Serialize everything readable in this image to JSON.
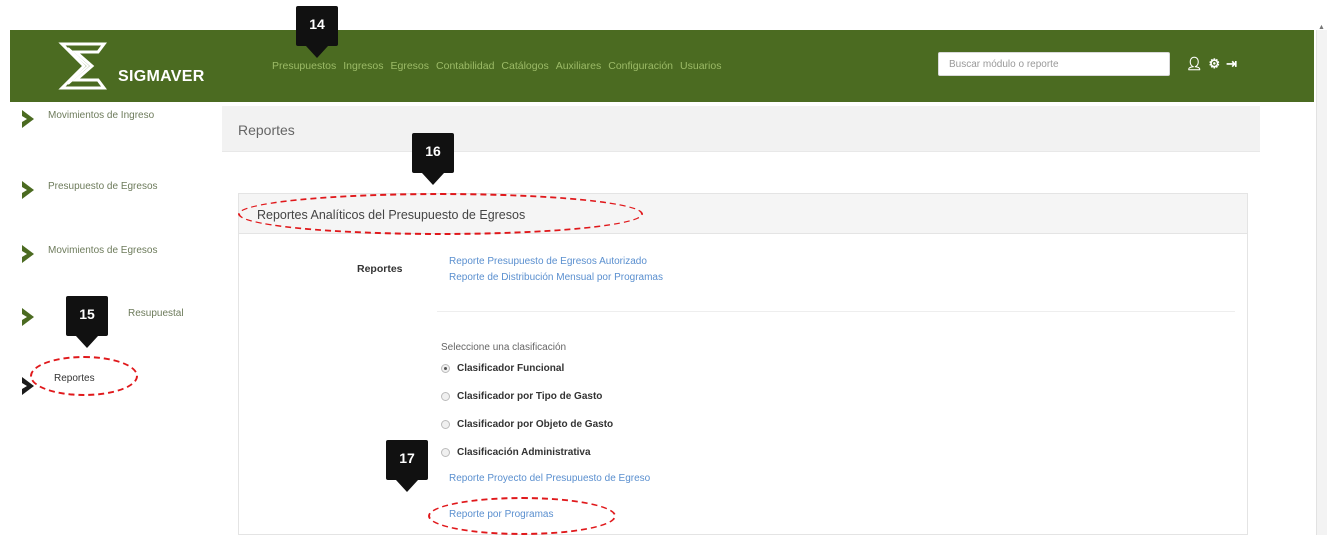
{
  "app": {
    "brand": "SIGMAVER",
    "nav": [
      "Presupuestos",
      "Ingresos",
      "Egresos",
      "Contabilidad",
      "Catálogos",
      "Auxiliares",
      "Configuración",
      "Usuarios"
    ],
    "search_placeholder": "Buscar módulo o reporte",
    "colors": {
      "topbar": "#4b6b21",
      "link": "#5a8fcf",
      "annotation": "#e0181b"
    }
  },
  "sidebar": {
    "items": [
      {
        "label": "Movimientos de Ingreso"
      },
      {
        "label": "Presupuesto de Egresos"
      },
      {
        "label": "Movimientos de Egresos"
      },
      {
        "label": "Resupuestal"
      },
      {
        "label": "Reportes"
      }
    ]
  },
  "main": {
    "page_title": "Reportes",
    "panel_title": "Reportes Analíticos del Presupuesto de Egresos",
    "reports_label": "Reportes",
    "report_links": [
      "Reporte Presupuesto de Egresos Autorizado",
      "Reporte de Distribución Mensual por Programas"
    ],
    "classification_title": "Seleccione una clasificación",
    "classifications": [
      {
        "label": "Clasificador Funcional",
        "checked": true
      },
      {
        "label": "Clasificador por Tipo de Gasto",
        "checked": false
      },
      {
        "label": "Clasificador por Objeto de Gasto",
        "checked": false
      },
      {
        "label": "Clasificación Administrativa",
        "checked": false
      }
    ],
    "bottom_links": [
      "Reporte Proyecto del Presupuesto de Egreso",
      "Reporte por Programas"
    ]
  },
  "annotations": {
    "numbers": [
      "14",
      "15",
      "16",
      "17"
    ]
  }
}
